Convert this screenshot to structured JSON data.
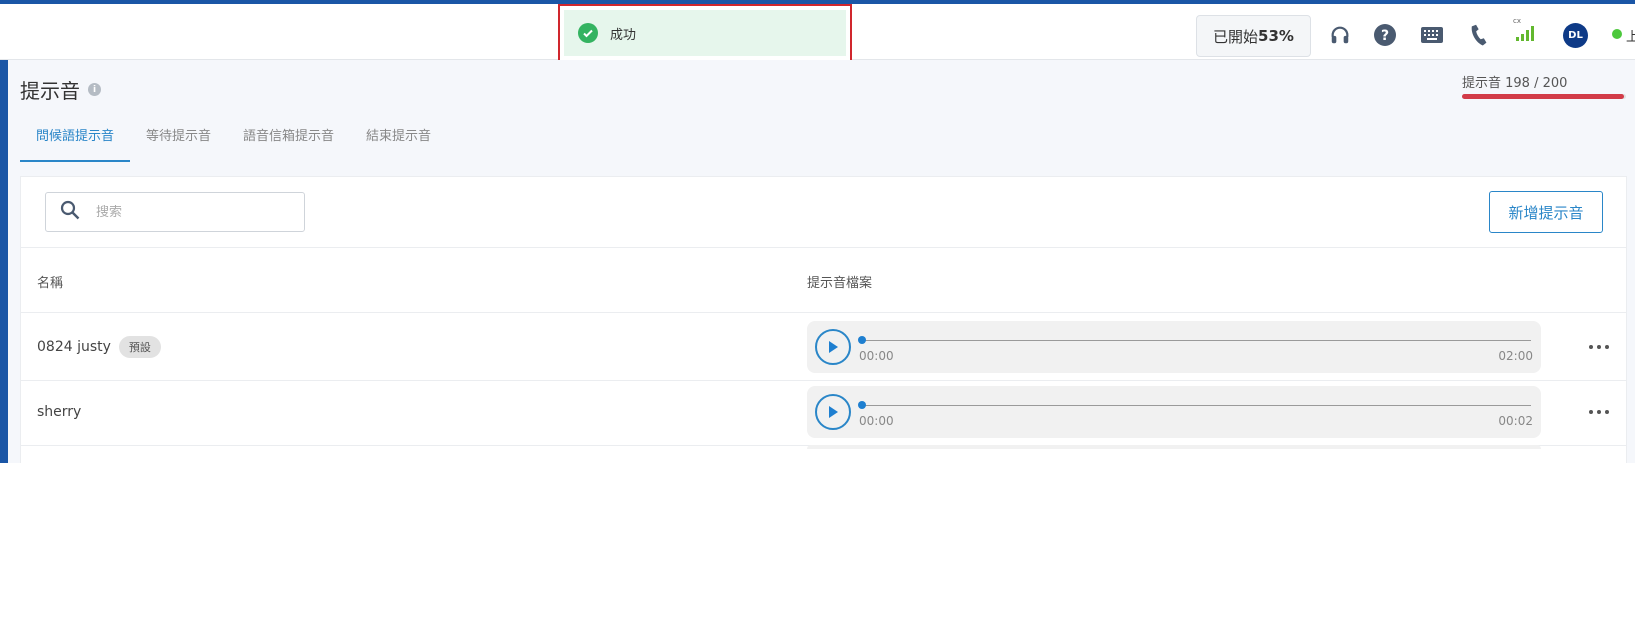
{
  "toast": {
    "message": "成功"
  },
  "header": {
    "progress_label": "已開始",
    "progress_value": "53%",
    "avatar_initials": "DL",
    "signal_label": "cx",
    "status_text": "上"
  },
  "page": {
    "title": "提示音",
    "quota_text": "提示音 198 / 200",
    "quota_used": 198,
    "quota_total": 200
  },
  "tabs": [
    {
      "label": "問候語提示音",
      "active": true
    },
    {
      "label": "等待提示音",
      "active": false
    },
    {
      "label": "語音信箱提示音",
      "active": false
    },
    {
      "label": "結束提示音",
      "active": false
    }
  ],
  "search": {
    "placeholder": "搜索"
  },
  "add_button": "新增提示音",
  "table": {
    "headers": {
      "name": "名稱",
      "file": "提示音檔案"
    },
    "rows": [
      {
        "name": "0824 justy",
        "badge": "預設",
        "current": "00:00",
        "duration": "02:00"
      },
      {
        "name": "sherry",
        "badge": "",
        "current": "00:00",
        "duration": "00:02"
      }
    ]
  },
  "colors": {
    "accent": "#2a86c8",
    "topbar": "#1a56a6",
    "success": "#34b361",
    "quota": "#d23b48"
  }
}
